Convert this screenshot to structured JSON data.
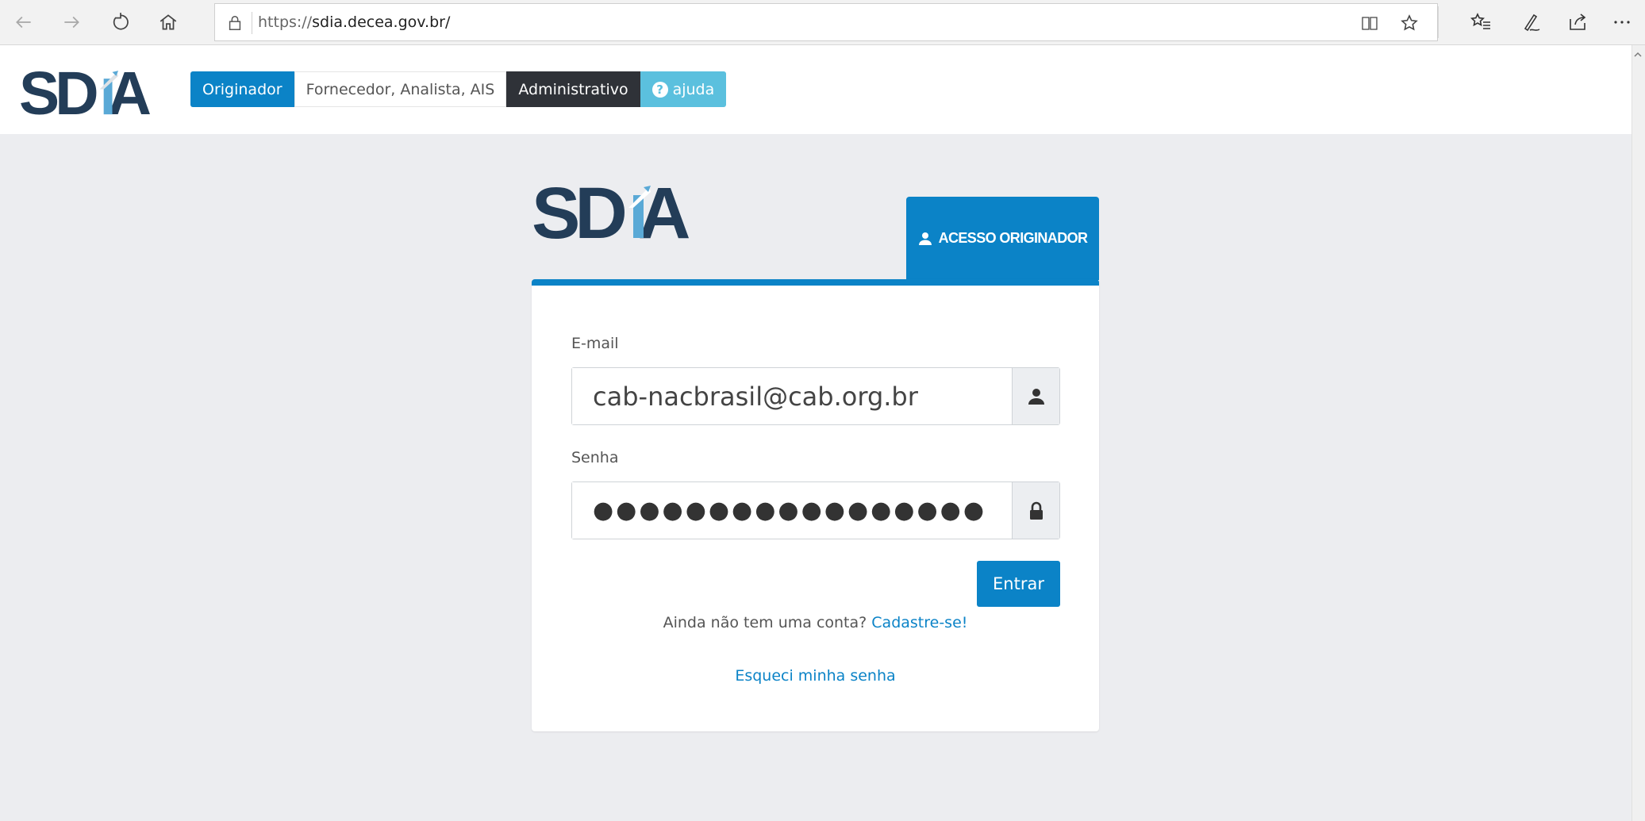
{
  "browser": {
    "url_protocol": "https://",
    "url_host": "sdia.decea.gov.br/",
    "icons": [
      "back-arrow-icon",
      "forward-arrow-icon",
      "refresh-icon",
      "home-icon",
      "lock-icon",
      "reading-view-icon",
      "star-icon",
      "favorites-icon",
      "pen-icon",
      "share-icon",
      "more-icon"
    ]
  },
  "header": {
    "logo_text": "SDIA",
    "tabs": {
      "originador": "Originador",
      "fornecedor": "Fornecedor, Analista, AIS",
      "administrativo": "Administrativo",
      "ajuda": "ajuda"
    },
    "help_glyph": "?"
  },
  "login": {
    "logo_text": "SDIA",
    "access_tab_label": "ACESSO ORIGINADOR",
    "email_label": "E-mail",
    "email_value": "cab-nacbrasil@cab.org.br",
    "password_label": "Senha",
    "password_value": "●●●●●●●●●●●●●●●●●",
    "submit_label": "Entrar",
    "signup_prompt": "Ainda não tem uma conta?",
    "signup_link": "Cadastre-se!",
    "forgot_link": "Esqueci minha senha"
  },
  "colors": {
    "primary": "#0b83c7",
    "logo_dark": "#233d58",
    "logo_light": "#5aa9d6",
    "admin_dark": "#2f3238",
    "help_cyan": "#5bc0de",
    "page_bg": "#ecedf0"
  }
}
